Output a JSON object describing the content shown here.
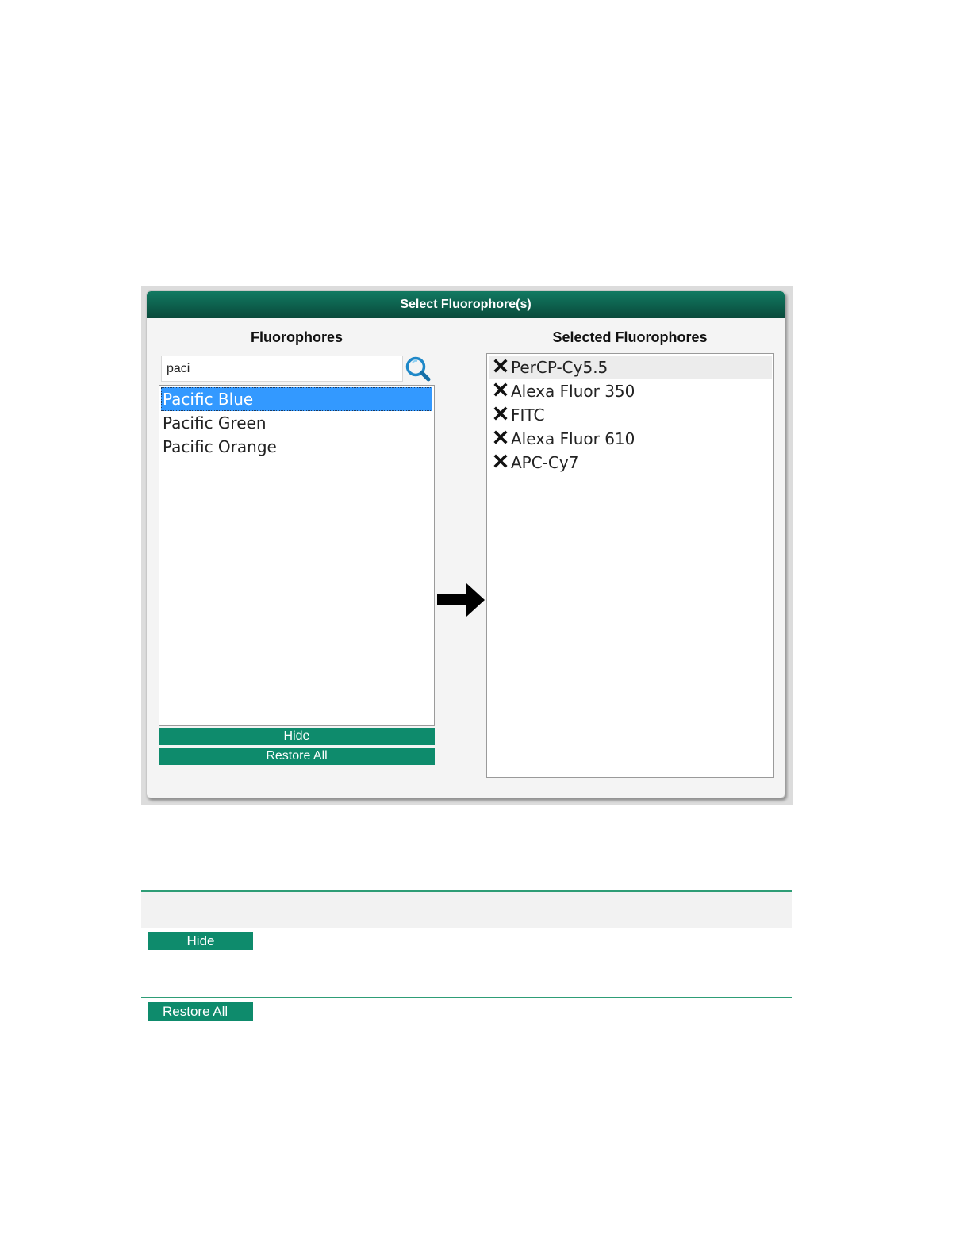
{
  "dialog": {
    "title": "Select Fluorophore(s)",
    "left_heading": "Fluorophores",
    "right_heading": "Selected Fluorophores",
    "search": {
      "value": "paci",
      "placeholder": ""
    },
    "available": [
      {
        "label": "Pacific Blue",
        "selected": true
      },
      {
        "label": "Pacific Green",
        "selected": false
      },
      {
        "label": "Pacific Orange",
        "selected": false
      }
    ],
    "selected": [
      {
        "label": "PerCP-Cy5.5",
        "highlighted": true
      },
      {
        "label": "Alexa Fluor 350",
        "highlighted": false
      },
      {
        "label": "FITC",
        "highlighted": false
      },
      {
        "label": "Alexa Fluor 610",
        "highlighted": false
      },
      {
        "label": "APC-Cy7",
        "highlighted": false
      }
    ],
    "hide_label": "Hide",
    "restore_label": "Restore All"
  },
  "doc_table": {
    "hide_label": "Hide",
    "restore_label": "Restore All"
  },
  "colors": {
    "title_bar": "#0d5f4c",
    "button_green": "#0e8b6c",
    "selection_blue": "#3399ff",
    "rule_green": "#2e9d76"
  },
  "icons": {
    "search": "search-icon",
    "remove": "remove-x-icon",
    "arrow": "arrow-right-icon"
  }
}
